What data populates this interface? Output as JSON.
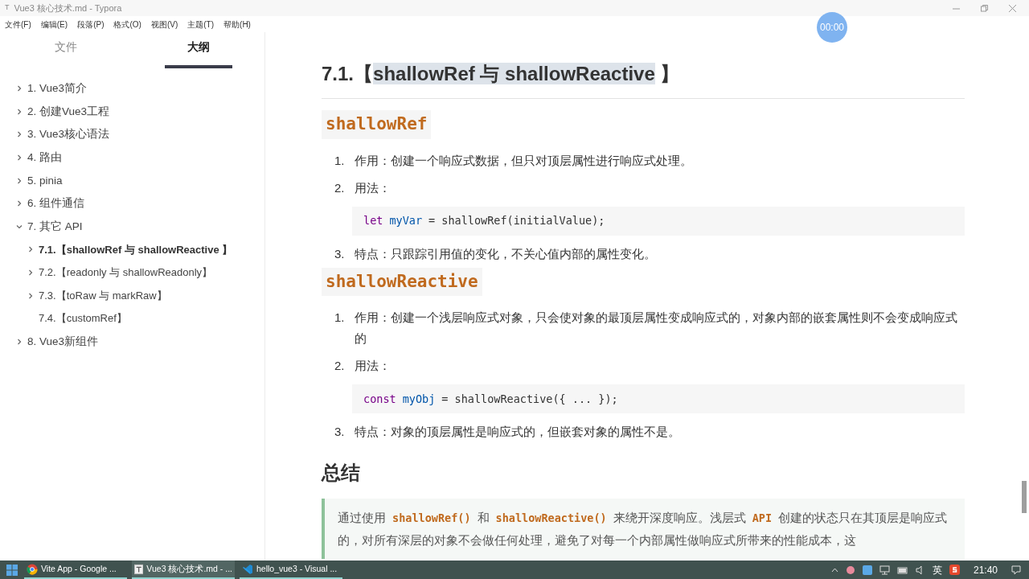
{
  "window": {
    "title": "Vue3 核心技术.md - Typora",
    "app_icon": "T"
  },
  "menu": [
    "文件(F)",
    "编辑(E)",
    "段落(P)",
    "格式(O)",
    "视图(V)",
    "主题(T)",
    "帮助(H)"
  ],
  "recorder": {
    "time": "00:00"
  },
  "sidebar": {
    "tabs": [
      {
        "label": "文件",
        "selected": false
      },
      {
        "label": "大纲",
        "selected": true
      }
    ],
    "items": [
      {
        "label": "1. Vue3简介",
        "expanded": false,
        "current": false
      },
      {
        "label": "2. 创建Vue3工程",
        "expanded": false,
        "current": false
      },
      {
        "label": "3. Vue3核心语法",
        "expanded": false,
        "current": false
      },
      {
        "label": "4. 路由",
        "expanded": false,
        "current": false
      },
      {
        "label": "5. pinia",
        "expanded": false,
        "current": false
      },
      {
        "label": "6. 组件通信",
        "expanded": false,
        "current": false
      },
      {
        "label": "7. 其它 API",
        "expanded": true,
        "current": false,
        "children": [
          {
            "label": "7.1.【shallowRef 与 shallowReactive 】",
            "current": true,
            "has_children": true
          },
          {
            "label": "7.2.【readonly 与 shallowReadonly】",
            "current": false,
            "has_children": true
          },
          {
            "label": "7.3.【toRaw 与 markRaw】",
            "current": false,
            "has_children": true
          },
          {
            "label": "7.4.【customRef】",
            "current": false,
            "has_children": false
          }
        ]
      },
      {
        "label": "8. Vue3新组件",
        "expanded": false,
        "current": false
      }
    ]
  },
  "document": {
    "blocks": [
      {
        "kind": "h2",
        "parts": [
          {
            "text": "7.1.【",
            "selected": false
          },
          {
            "text": "shallowRef 与 shallowReactive",
            "selected": true
          },
          {
            "text": " 】",
            "selected": false
          }
        ],
        "rule": true
      },
      {
        "kind": "h3",
        "text": "shallowRef"
      },
      {
        "kind": "item",
        "number": "1.",
        "text": "作用：创建一个响应式数据，但只对顶层属性进行响应式处理。"
      },
      {
        "kind": "item",
        "number": "2.",
        "text": "用法："
      },
      {
        "kind": "code",
        "tokens": [
          {
            "kind": "keyword",
            "text": "let"
          },
          {
            "kind": "variable",
            "text": "myVar"
          },
          {
            "kind": "plain",
            "text": "= shallowRef(initialValue);"
          }
        ]
      },
      {
        "kind": "item",
        "number": "3.",
        "text": "特点：只跟踪引用值的变化，不关心值内部的属性变化。"
      },
      {
        "kind": "h3",
        "text": "shallowReactive"
      },
      {
        "kind": "item",
        "number": "1.",
        "text": "作用：创建一个浅层响应式对象，只会使对象的最顶层属性变成响应式的，对象内部的嵌套属性则不会变成响应式的"
      },
      {
        "kind": "item",
        "number": "2.",
        "text": "用法："
      },
      {
        "kind": "code",
        "tokens": [
          {
            "kind": "keyword",
            "text": "const"
          },
          {
            "kind": "variable",
            "text": "myObj"
          },
          {
            "kind": "plain",
            "text": "= shallowReactive({ ... });"
          }
        ]
      },
      {
        "kind": "item",
        "number": "3.",
        "text": "特点：对象的顶层属性是响应式的，但嵌套对象的属性不是。"
      },
      {
        "kind": "h2",
        "parts": [
          {
            "text": "总结",
            "selected": false
          }
        ],
        "rule": false
      },
      {
        "kind": "quote",
        "parts": [
          {
            "kind": "text",
            "text": "通过使用"
          },
          {
            "kind": "code",
            "text": "shallowRef()"
          },
          {
            "kind": "text",
            "text": "和"
          },
          {
            "kind": "code",
            "text": "shallowReactive()"
          },
          {
            "kind": "text",
            "text": "来绕开深度响应。浅层式"
          },
          {
            "kind": "code",
            "text": "API"
          },
          {
            "kind": "text",
            "text": "创建的状态只在其顶层是响应式的，对所有深层的对象不会做任何处理，避免了对每一个内部属性做响应式所带来的性能成本，这"
          }
        ]
      }
    ]
  },
  "taskbar": {
    "apps": [
      {
        "label": "Vite App - Google ...",
        "kind": "browser",
        "active": false
      },
      {
        "label": "Vue3 核心技术.md - ...",
        "kind": "typora",
        "active": true
      },
      {
        "label": "hello_vue3 - Visual ...",
        "kind": "editor",
        "active": false
      }
    ],
    "tray": {
      "ime": "英",
      "time": "21:40"
    }
  }
}
